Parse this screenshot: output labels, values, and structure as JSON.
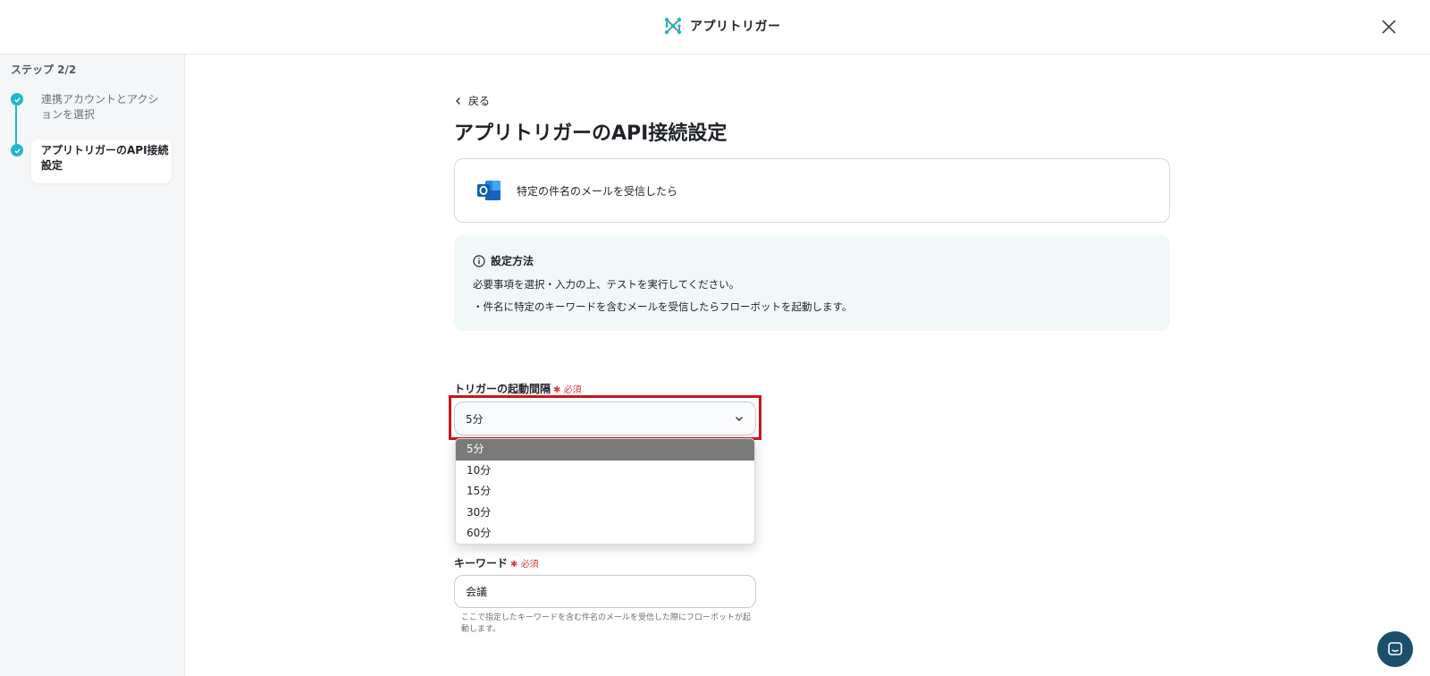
{
  "header": {
    "title": "アプリトリガー",
    "brand_icon": "network-nodes-icon",
    "close_icon": "close-icon"
  },
  "sidebar": {
    "step_count": "ステップ 2/2",
    "steps": [
      {
        "label": "連携アカウントとアクションを選択",
        "status": "done"
      },
      {
        "label": "アプリトリガーのAPI接続設定",
        "status": "current"
      }
    ]
  },
  "main": {
    "back_label": "戻る",
    "page_title": "アプリトリガーのAPI接続設定",
    "app_card": {
      "icon": "outlook-icon",
      "text": "特定の件名のメールを受信したら"
    },
    "info": {
      "heading": "設定方法",
      "lines": [
        "必要事項を選択・入力の上、テストを実行してください。",
        "・件名に特定のキーワードを含むメールを受信したらフローボットを起動します。"
      ]
    },
    "interval_field": {
      "label": "トリガーの起動間隔",
      "required_mark": "✱",
      "required_label": "必須",
      "value": "5分",
      "options": [
        "5分",
        "10分",
        "15分",
        "30分",
        "60分"
      ],
      "selected_index": 0
    },
    "keyword_field": {
      "label": "キーワード",
      "required_mark": "✱",
      "required_label": "必須",
      "value": "会議",
      "help": "ここで指定したキーワードを含む件名のメールを受信した際にフローボットが起動します。"
    }
  },
  "colors": {
    "accent_teal": "#1fb8c8",
    "highlight_red": "#c8161d",
    "required_red": "#d63b3b",
    "chat_button": "#1b4f6b"
  }
}
